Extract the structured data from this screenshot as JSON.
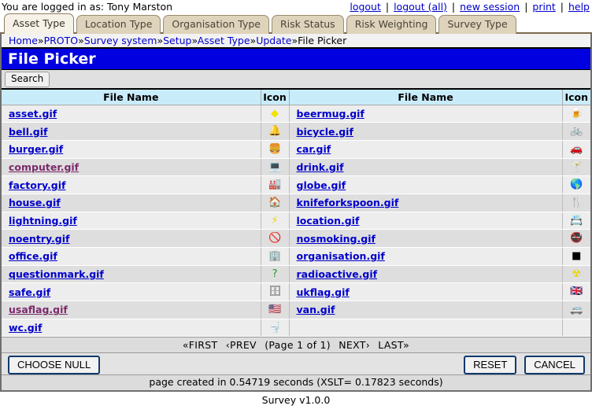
{
  "topbar": {
    "logged_in_text": "You are logged in as: Tony Marston",
    "links": [
      {
        "label": "logout",
        "name": "logout-link"
      },
      {
        "label": "logout (all)",
        "name": "logout-all-link"
      },
      {
        "label": "new session",
        "name": "new-session-link"
      },
      {
        "label": "print",
        "name": "print-link"
      },
      {
        "label": "help",
        "name": "help-link"
      }
    ],
    "separator": "|"
  },
  "tabs": [
    {
      "label": "Asset Type",
      "active": true
    },
    {
      "label": "Location Type",
      "active": false
    },
    {
      "label": "Organisation Type",
      "active": false
    },
    {
      "label": "Risk Status",
      "active": false
    },
    {
      "label": "Risk Weighting",
      "active": false
    },
    {
      "label": "Survey Type",
      "active": false
    }
  ],
  "breadcrumb": {
    "separator": "»",
    "items": [
      {
        "label": "Home",
        "link": true
      },
      {
        "label": "PROTO",
        "link": true
      },
      {
        "label": "Survey system",
        "link": true
      },
      {
        "label": "Setup",
        "link": true
      },
      {
        "label": "Asset Type",
        "link": true
      },
      {
        "label": "Update",
        "link": true
      },
      {
        "label": "File Picker",
        "link": false
      }
    ]
  },
  "title": "File Picker",
  "toolbar": {
    "search_label": "Search"
  },
  "table": {
    "headers": [
      "File Name",
      "Icon",
      "File Name",
      "Icon"
    ],
    "rows": [
      {
        "left": {
          "file": "asset.gif",
          "visited": false,
          "icon": "diamond-icon",
          "glyph": "◆",
          "color": "#f2e200"
        },
        "right": {
          "file": "beermug.gif",
          "visited": false,
          "icon": "beermug-icon",
          "glyph": "🍺",
          "color": "#c98a12"
        }
      },
      {
        "left": {
          "file": "bell.gif",
          "visited": false,
          "icon": "bell-icon",
          "glyph": "🔔",
          "color": "#555555"
        },
        "right": {
          "file": "bicycle.gif",
          "visited": false,
          "icon": "bicycle-icon",
          "glyph": "🚲",
          "color": "#b00020"
        }
      },
      {
        "left": {
          "file": "burger.gif",
          "visited": false,
          "icon": "burger-icon",
          "glyph": "🍔",
          "color": "#d06a10"
        },
        "right": {
          "file": "car.gif",
          "visited": false,
          "icon": "car-icon",
          "glyph": "🚗",
          "color": "#2a58b8"
        }
      },
      {
        "left": {
          "file": "computer.gif",
          "visited": true,
          "icon": "computer-icon",
          "glyph": "💻",
          "color": "#555555"
        },
        "right": {
          "file": "drink.gif",
          "visited": false,
          "icon": "cocktail-icon",
          "glyph": "🍸",
          "color": "#1fa0c8"
        }
      },
      {
        "left": {
          "file": "factory.gif",
          "visited": false,
          "icon": "factory-icon",
          "glyph": "🏭",
          "color": "#c02020"
        },
        "right": {
          "file": "globe.gif",
          "visited": false,
          "icon": "globe-icon",
          "glyph": "🌎",
          "color": "#1b8a2a"
        }
      },
      {
        "left": {
          "file": "house.gif",
          "visited": false,
          "icon": "house-icon",
          "glyph": "🏠",
          "color": "#b2521a"
        },
        "right": {
          "file": "knifeforkspoon.gif",
          "visited": false,
          "icon": "cutlery-icon",
          "glyph": "🍴",
          "color": "#555555"
        }
      },
      {
        "left": {
          "file": "lightning.gif",
          "visited": false,
          "icon": "lightning-icon",
          "glyph": "⚡",
          "color": "#e8d400"
        },
        "right": {
          "file": "location.gif",
          "visited": false,
          "icon": "location-card-icon",
          "glyph": "📇",
          "color": "#333333"
        }
      },
      {
        "left": {
          "file": "noentry.gif",
          "visited": false,
          "icon": "no-entry-icon",
          "glyph": "🚫",
          "color": "#d80000"
        },
        "right": {
          "file": "nosmoking.gif",
          "visited": false,
          "icon": "no-smoking-icon",
          "glyph": "🚭",
          "color": "#d80000"
        }
      },
      {
        "left": {
          "file": "office.gif",
          "visited": false,
          "icon": "office-icon",
          "glyph": "🏢",
          "color": "#1a7a82"
        },
        "right": {
          "file": "organisation.gif",
          "visited": false,
          "icon": "square-icon",
          "glyph": "■",
          "color": "#000000"
        }
      },
      {
        "left": {
          "file": "questionmark.gif",
          "visited": false,
          "icon": "question-mark-icon",
          "glyph": "?",
          "color": "#1b9a1b"
        },
        "right": {
          "file": "radioactive.gif",
          "visited": false,
          "icon": "radioactive-icon",
          "glyph": "☢",
          "color": "#e8d400"
        }
      },
      {
        "left": {
          "file": "safe.gif",
          "visited": false,
          "icon": "safe-icon",
          "glyph": "🗄",
          "color": "#5a5a5a"
        },
        "right": {
          "file": "ukflag.gif",
          "visited": false,
          "icon": "uk-flag-icon",
          "glyph": "🇬🇧",
          "color": "#1a3a8a"
        }
      },
      {
        "left": {
          "file": "usaflag.gif",
          "visited": true,
          "icon": "usa-flag-icon",
          "glyph": "🇺🇸",
          "color": "#b00020"
        },
        "right": {
          "file": "van.gif",
          "visited": false,
          "icon": "van-icon",
          "glyph": "🚐",
          "color": "#3a86d0"
        }
      },
      {
        "left": {
          "file": "wc.gif",
          "visited": false,
          "icon": "toilet-icon",
          "glyph": "🚽",
          "color": "#333333"
        },
        "right": {
          "file": "",
          "visited": false,
          "icon": "",
          "glyph": "",
          "color": ""
        }
      }
    ]
  },
  "pager": {
    "first": "«FIRST",
    "prev": "‹PREV",
    "page_info": "(Page 1 of 1)",
    "next": "NEXT›",
    "last": "LAST»"
  },
  "actions": {
    "choose_null": "CHOOSE NULL",
    "reset": "RESET",
    "cancel": "CANCEL"
  },
  "footer": {
    "timing": "page created in 0.54719 seconds (XSLT= 0.17823 seconds)",
    "version": "Survey v1.0.0"
  },
  "colors": {
    "title_bg": "#0000e0",
    "header_bg": "#c9ecfb",
    "link": "#0000cc",
    "visited_link": "#7b2a6b",
    "tab_active": "#f6f2e8",
    "tab_inactive": "#ded3bb"
  }
}
